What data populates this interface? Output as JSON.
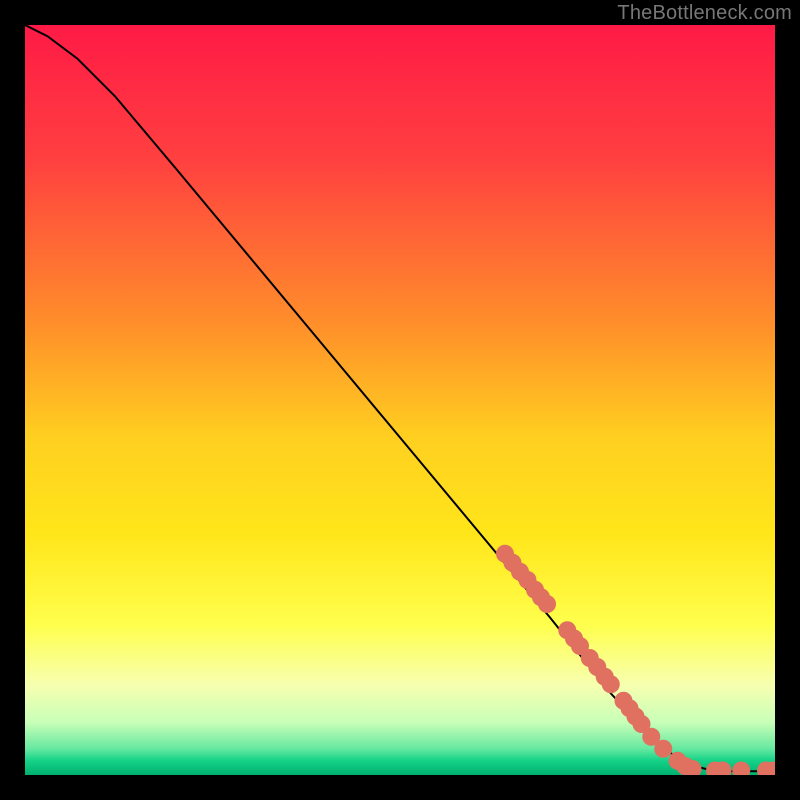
{
  "attribution": "TheBottleneck.com",
  "chart_data": {
    "type": "line",
    "title": "",
    "xlabel": "",
    "ylabel": "",
    "xlim": [
      0,
      100
    ],
    "ylim": [
      0,
      100
    ],
    "gradient_stops": [
      {
        "pct": 0,
        "color": "#ff1a46"
      },
      {
        "pct": 18,
        "color": "#ff4040"
      },
      {
        "pct": 40,
        "color": "#ff8f2a"
      },
      {
        "pct": 55,
        "color": "#ffcf20"
      },
      {
        "pct": 68,
        "color": "#ffe61a"
      },
      {
        "pct": 80,
        "color": "#ffff4d"
      },
      {
        "pct": 88,
        "color": "#f7ffb0"
      },
      {
        "pct": 93,
        "color": "#c8ffb8"
      },
      {
        "pct": 96.5,
        "color": "#66e8a0"
      },
      {
        "pct": 98,
        "color": "#17d388"
      },
      {
        "pct": 100,
        "color": "#00b070"
      }
    ],
    "series": [
      {
        "name": "curve",
        "type": "line",
        "stroke": "#000000",
        "points": [
          {
            "x": 0,
            "y": 100
          },
          {
            "x": 3,
            "y": 98.5
          },
          {
            "x": 7,
            "y": 95.5
          },
          {
            "x": 12,
            "y": 90.5
          },
          {
            "x": 20,
            "y": 81
          },
          {
            "x": 30,
            "y": 69
          },
          {
            "x": 40,
            "y": 57
          },
          {
            "x": 50,
            "y": 45
          },
          {
            "x": 60,
            "y": 33
          },
          {
            "x": 70,
            "y": 21
          },
          {
            "x": 78,
            "y": 11
          },
          {
            "x": 84,
            "y": 4.5
          },
          {
            "x": 88,
            "y": 1.5
          },
          {
            "x": 92,
            "y": 0.5
          },
          {
            "x": 100,
            "y": 0.5
          }
        ]
      },
      {
        "name": "markers",
        "type": "scatter",
        "marker_color": "#e07060",
        "marker_radius_px": 9,
        "points": [
          {
            "x": 64,
            "y": 29.5
          },
          {
            "x": 65,
            "y": 28.3
          },
          {
            "x": 66,
            "y": 27.1
          },
          {
            "x": 67,
            "y": 26.0
          },
          {
            "x": 68,
            "y": 24.7
          },
          {
            "x": 68.8,
            "y": 23.7
          },
          {
            "x": 69.6,
            "y": 22.8
          },
          {
            "x": 72.3,
            "y": 19.3
          },
          {
            "x": 73.2,
            "y": 18.2
          },
          {
            "x": 74.0,
            "y": 17.2
          },
          {
            "x": 75.3,
            "y": 15.6
          },
          {
            "x": 76.3,
            "y": 14.4
          },
          {
            "x": 77.3,
            "y": 13.1
          },
          {
            "x": 78.1,
            "y": 12.1
          },
          {
            "x": 79.8,
            "y": 9.9
          },
          {
            "x": 80.6,
            "y": 8.9
          },
          {
            "x": 81.4,
            "y": 7.8
          },
          {
            "x": 82.2,
            "y": 6.8
          },
          {
            "x": 83.5,
            "y": 5.1
          },
          {
            "x": 85.1,
            "y": 3.5
          },
          {
            "x": 87.0,
            "y": 1.9
          },
          {
            "x": 88.0,
            "y": 1.2
          },
          {
            "x": 89.0,
            "y": 0.8
          },
          {
            "x": 92.0,
            "y": 0.6
          },
          {
            "x": 93.0,
            "y": 0.6
          },
          {
            "x": 95.5,
            "y": 0.6
          },
          {
            "x": 98.8,
            "y": 0.6
          },
          {
            "x": 99.8,
            "y": 0.6
          }
        ]
      }
    ]
  }
}
